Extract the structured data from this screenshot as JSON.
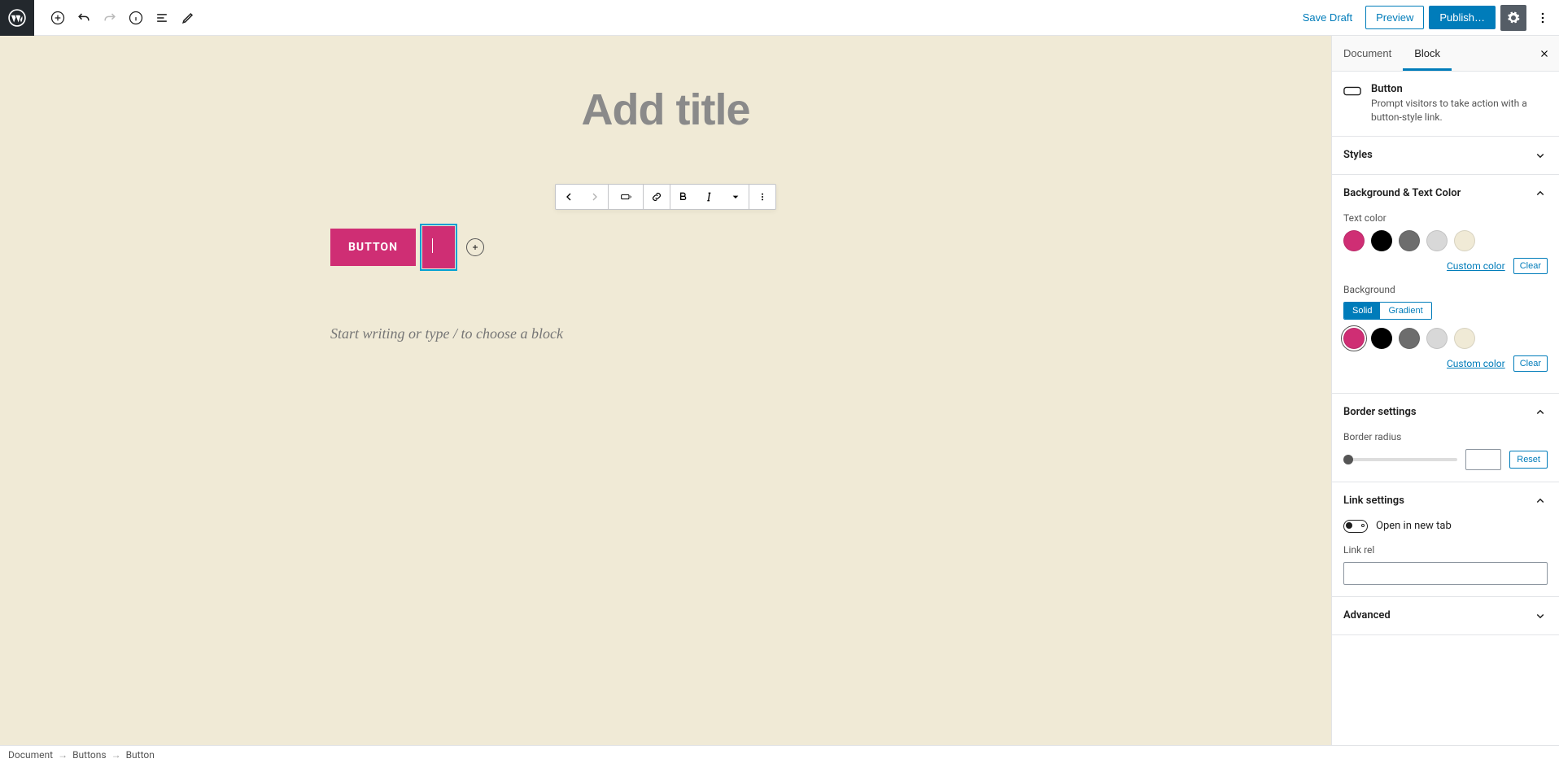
{
  "top": {
    "save_draft": "Save Draft",
    "preview": "Preview",
    "publish": "Publish…"
  },
  "canvas": {
    "title_placeholder": "Add title",
    "button_text": "BUTTON",
    "paragraph_placeholder": "Start writing or type / to choose a block"
  },
  "sidebar": {
    "tabs": {
      "document": "Document",
      "block": "Block"
    },
    "block_info": {
      "name": "Button",
      "description": "Prompt visitors to take action with a button-style link."
    },
    "panels": {
      "styles": "Styles",
      "colors": "Background & Text Color",
      "text_color_label": "Text color",
      "background_label": "Background",
      "custom_color": "Custom color",
      "clear": "Clear",
      "bg_solid": "Solid",
      "bg_gradient": "Gradient",
      "border": "Border settings",
      "border_radius_label": "Border radius",
      "reset": "Reset",
      "link": "Link settings",
      "open_new_tab": "Open in new tab",
      "link_rel": "Link rel",
      "advanced": "Advanced"
    },
    "swatches": [
      "#cf2e74",
      "#000000",
      "#6d6d6d",
      "#d8d8d8",
      "#f0ead6"
    ]
  },
  "breadcrumb": [
    "Document",
    "Buttons",
    "Button"
  ]
}
